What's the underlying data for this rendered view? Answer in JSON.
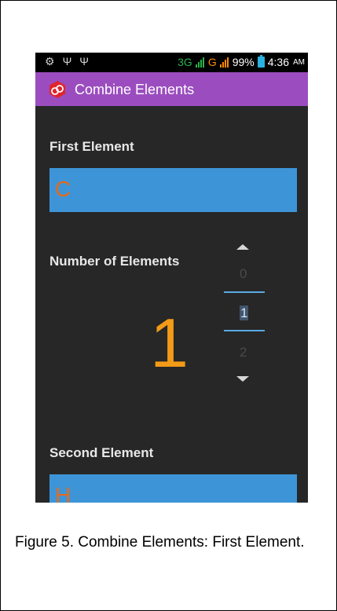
{
  "status_bar": {
    "network_3g": "3G",
    "network_g": "G",
    "battery": "99%",
    "time": "4:36",
    "ampm": "AM",
    "icons": [
      "notification-icon",
      "usb-icon",
      "usb-icon"
    ],
    "colors": {
      "green": "#2bb24c",
      "orange": "#ff8a00",
      "battery": "#2bb2e0"
    }
  },
  "app_bar": {
    "title": "Combine Elements",
    "color": "#9b4dbf"
  },
  "first_element": {
    "label": "First Element",
    "value": "C"
  },
  "number_of_elements": {
    "label": "Number of Elements",
    "selected_display": "1",
    "picker": {
      "previous": "0",
      "selected": "1",
      "next": "2"
    }
  },
  "second_element": {
    "label": "Second Element",
    "value": "H"
  },
  "caption": {
    "text": "Figure 5. Combine Elements: First Element."
  },
  "accent": {
    "field_bg": "#3d95d8",
    "value_color": "#e66a1a",
    "number_color": "#f39a17"
  }
}
